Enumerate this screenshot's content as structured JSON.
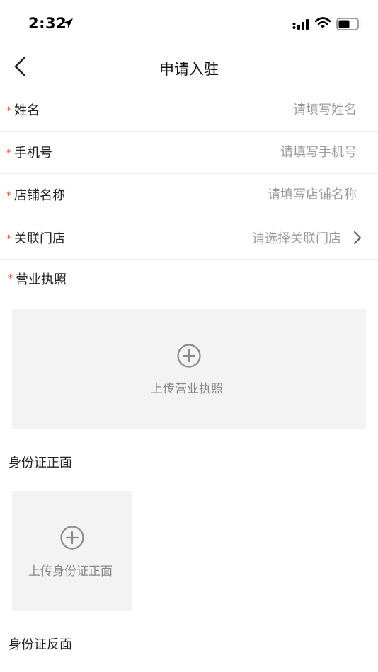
{
  "status_bar": {
    "time": "2:32"
  },
  "nav": {
    "title": "申请入驻"
  },
  "form": {
    "required_mark": "*",
    "name": {
      "label": "姓名",
      "placeholder": "请填写姓名"
    },
    "phone": {
      "label": "手机号",
      "placeholder": "请填写手机号"
    },
    "shop_name": {
      "label": "店铺名称",
      "placeholder": "请填写店铺名称"
    },
    "linked_store": {
      "label": "关联门店",
      "placeholder": "请选择关联门店"
    }
  },
  "business_license": {
    "label": "营业执照",
    "upload_text": "上传营业执照"
  },
  "id_front": {
    "label": "身份证正面",
    "upload_text": "上传身份证正面"
  },
  "id_back": {
    "label": "身份证反面"
  },
  "colors": {
    "required": "#e55a3c",
    "placeholder": "#999999",
    "upload_bg": "#f3f3f3"
  }
}
